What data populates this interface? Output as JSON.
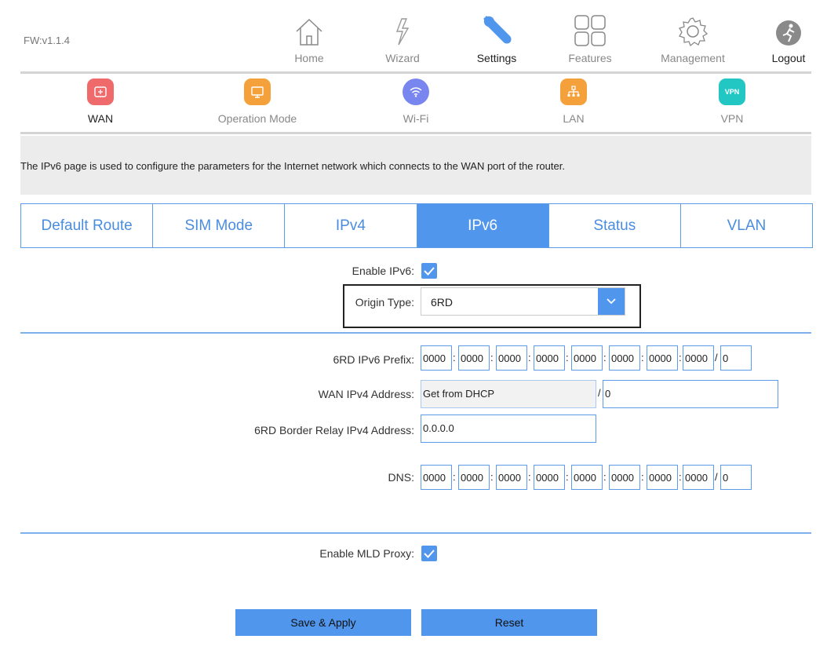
{
  "firmware": "FW:v1.1.4",
  "topnav": {
    "home": "Home",
    "wizard": "Wizard",
    "settings": "Settings",
    "features": "Features",
    "management": "Management",
    "logout": "Logout"
  },
  "subnav": {
    "wan": "WAN",
    "operation_mode": "Operation Mode",
    "wifi": "Wi-Fi",
    "lan": "LAN",
    "vpn": "VPN",
    "vpn_badge": "VPN"
  },
  "description": "The IPv6 page is used to configure the parameters for the Internet network which connects to the WAN port of the router.",
  "tabs": [
    "Default Route",
    "SIM Mode",
    "IPv4",
    "IPv6",
    "Status",
    "VLAN"
  ],
  "form": {
    "enable_ipv6_label": "Enable IPv6:",
    "origin_type_label": "Origin Type:",
    "origin_type_value": "6RD",
    "prefix_label": "6RD IPv6 Prefix:",
    "prefix_segments": [
      "0000",
      "0000",
      "0000",
      "0000",
      "0000",
      "0000",
      "0000",
      "0000"
    ],
    "prefix_length": "0",
    "wan_ipv4_label": "WAN IPv4 Address:",
    "wan_ipv4_value": "Get from DHCP",
    "wan_ipv4_mask": "0",
    "border_relay_label": "6RD Border Relay IPv4 Address:",
    "border_relay_value": "0.0.0.0",
    "dns_label": "DNS:",
    "dns_segments": [
      "0000",
      "0000",
      "0000",
      "0000",
      "0000",
      "0000",
      "0000",
      "0000"
    ],
    "dns_length": "0",
    "mld_proxy_label": "Enable MLD Proxy:"
  },
  "buttons": {
    "save": "Save & Apply",
    "reset": "Reset"
  },
  "colors": {
    "accent": "#4f96ec",
    "wan": "#ef6b6b",
    "operation_mode": "#f5a13b",
    "wifi": "#7a86f0",
    "lan": "#f5a13b",
    "vpn": "#22c7c4"
  }
}
